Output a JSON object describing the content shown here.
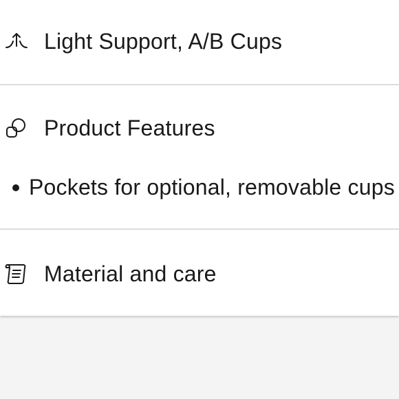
{
  "details": {
    "support": {
      "icon": "support-arc-icon",
      "label": "Light Support, A/B Cups"
    },
    "features": {
      "icon": "overlapping-shapes-icon",
      "label": "Product Features",
      "bullets": [
        "Pockets for optional, removable cups"
      ]
    },
    "material": {
      "icon": "scroll-care-label-icon",
      "label": "Material and care"
    }
  },
  "colors": {
    "text": "#1a1a1a",
    "divider": "#dcdcdc",
    "panel": "#ffffff",
    "background": "#f4f4f4"
  }
}
